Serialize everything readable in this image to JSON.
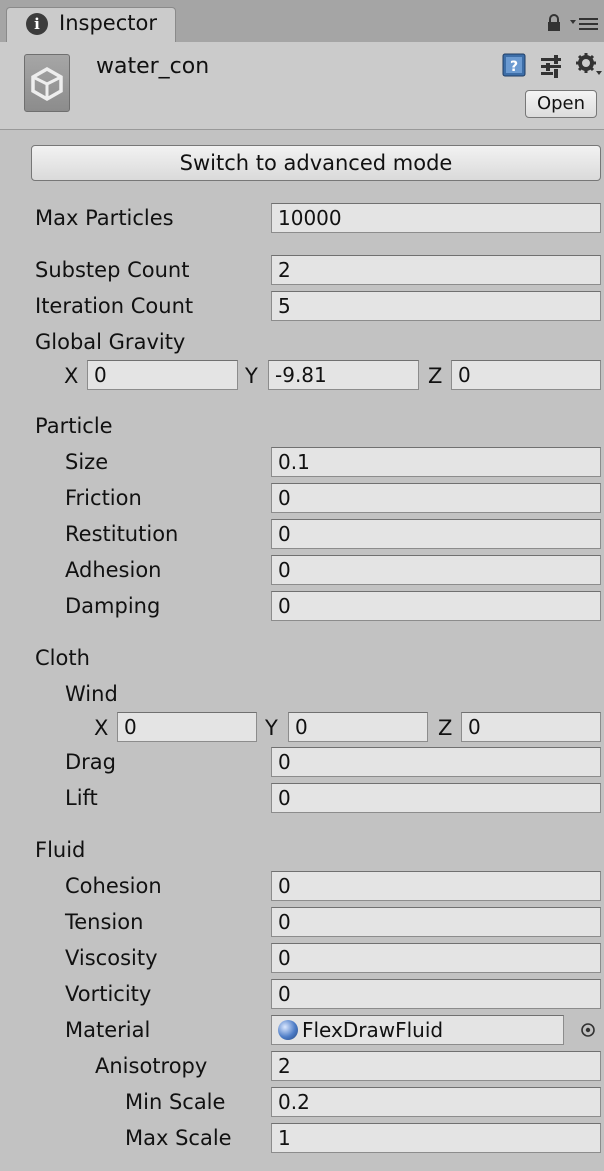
{
  "tab": {
    "title": "Inspector"
  },
  "header": {
    "asset_name": "water_con",
    "open_label": "Open"
  },
  "advanced_button": "Switch to advanced mode",
  "max_particles": {
    "label": "Max Particles",
    "value": "10000"
  },
  "substep_count": {
    "label": "Substep Count",
    "value": "2"
  },
  "iteration_count": {
    "label": "Iteration Count",
    "value": "5"
  },
  "global_gravity": {
    "label": "Global Gravity",
    "x": "0",
    "y": "-9.81",
    "z": "0"
  },
  "axis_labels": {
    "x": "X",
    "y": "Y",
    "z": "Z"
  },
  "particle": {
    "section": "Particle",
    "size": {
      "label": "Size",
      "value": "0.1"
    },
    "friction": {
      "label": "Friction",
      "value": "0"
    },
    "restitution": {
      "label": "Restitution",
      "value": "0"
    },
    "adhesion": {
      "label": "Adhesion",
      "value": "0"
    },
    "damping": {
      "label": "Damping",
      "value": "0"
    }
  },
  "cloth": {
    "section": "Cloth",
    "wind": {
      "label": "Wind",
      "x": "0",
      "y": "0",
      "z": "0"
    },
    "drag": {
      "label": "Drag",
      "value": "0"
    },
    "lift": {
      "label": "Lift",
      "value": "0"
    }
  },
  "fluid": {
    "section": "Fluid",
    "cohesion": {
      "label": "Cohesion",
      "value": "0"
    },
    "tension": {
      "label": "Tension",
      "value": "0"
    },
    "viscosity": {
      "label": "Viscosity",
      "value": "0"
    },
    "vorticity": {
      "label": "Vorticity",
      "value": "0"
    },
    "material": {
      "label": "Material",
      "value": "FlexDrawFluid"
    },
    "anisotropy": {
      "label": "Anisotropy",
      "value": "2"
    },
    "min_scale": {
      "label": "Min Scale",
      "value": "0.2"
    },
    "max_scale": {
      "label": "Max Scale",
      "value": "1"
    }
  },
  "icons": {
    "tab": "info-icon",
    "lock": "lock-icon",
    "menu": "kebab-menu-icon",
    "asset": "unity-logo-icon",
    "help": "help-book-icon",
    "presets": "presets-sliders-icon",
    "settings": "gear-icon",
    "material": "sphere-material-icon",
    "picker": "object-picker-icon"
  }
}
